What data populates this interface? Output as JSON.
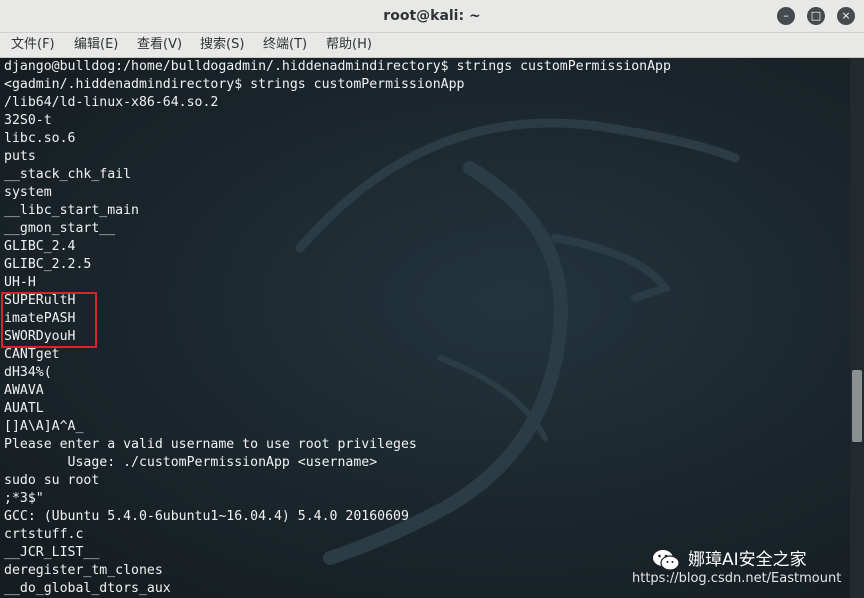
{
  "window": {
    "title": "root@kali: ~",
    "minimize_glyph": "–",
    "maximize_glyph": "□",
    "close_glyph": "×"
  },
  "menu": {
    "items": [
      "文件(F)",
      "编辑(E)",
      "查看(V)",
      "搜索(S)",
      "终端(T)",
      "帮助(H)"
    ]
  },
  "terminal": {
    "lines": [
      "django@bulldog:/home/bulldogadmin/.hiddenadmindirectory$ strings customPermissionApp",
      "<gadmin/.hiddenadmindirectory$ strings customPermissionApp",
      "/lib64/ld-linux-x86-64.so.2",
      "32S0-t",
      "libc.so.6",
      "puts",
      "__stack_chk_fail",
      "system",
      "__libc_start_main",
      "__gmon_start__",
      "GLIBC_2.4",
      "GLIBC_2.2.5",
      "UH-H",
      "SUPERultH",
      "imatePASH",
      "SWORDyouH",
      "CANTget",
      "dH34%(",
      "AWAVA",
      "AUATL",
      "[]A\\A]A^A_",
      "Please enter a valid username to use root privileges",
      "        Usage: ./customPermissionApp <username>",
      "sudo su root",
      ";*3$\"",
      "GCC: (Ubuntu 5.4.0-6ubuntu1~16.04.4) 5.4.0 20160609",
      "crtstuff.c",
      "__JCR_LIST__",
      "deregister_tm_clones",
      "__do_global_dtors_aux"
    ]
  },
  "watermark": {
    "brand": "娜璋AI安全之家",
    "url": "https://blog.csdn.net/Eastmount"
  },
  "colors": {
    "terminal_bg": "#1b2125",
    "terminal_text": "#f2f2f2",
    "highlight_box": "#d8242b",
    "chrome_bg": "#e8e8e7"
  }
}
